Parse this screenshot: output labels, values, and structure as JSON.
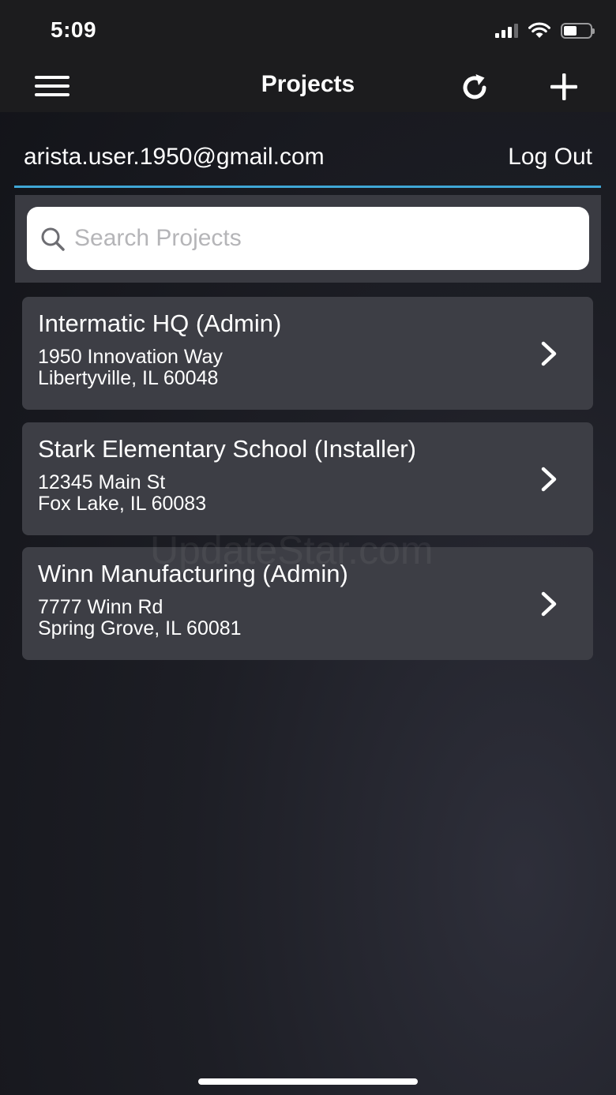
{
  "status_bar": {
    "time": "5:09",
    "icons": [
      "cellular-signal-icon",
      "wifi-icon",
      "battery-icon"
    ]
  },
  "nav": {
    "title": "Projects",
    "menu_icon": "hamburger-menu-icon",
    "refresh_icon": "refresh-icon",
    "add_icon": "plus-icon"
  },
  "account": {
    "email": "arista.user.1950@gmail.com",
    "logout_label": "Log Out"
  },
  "search": {
    "placeholder": "Search Projects",
    "value": ""
  },
  "projects": [
    {
      "name": "Intermatic HQ (Admin)",
      "address_line1": "1950 Innovation Way",
      "address_line2": "Libertyville, IL 60048"
    },
    {
      "name": "Stark Elementary School (Installer)",
      "address_line1": "12345 Main St",
      "address_line2": "Fox Lake, IL 60083"
    },
    {
      "name": "Winn Manufacturing (Admin)",
      "address_line1": "7777 Winn Rd",
      "address_line2": "Spring Grove, IL 60081"
    }
  ],
  "watermark": "UpdateStar.com",
  "colors": {
    "accent": "#3fa7d6",
    "nav_background": "#1c1c1e",
    "card_background": "#3d3e45"
  }
}
